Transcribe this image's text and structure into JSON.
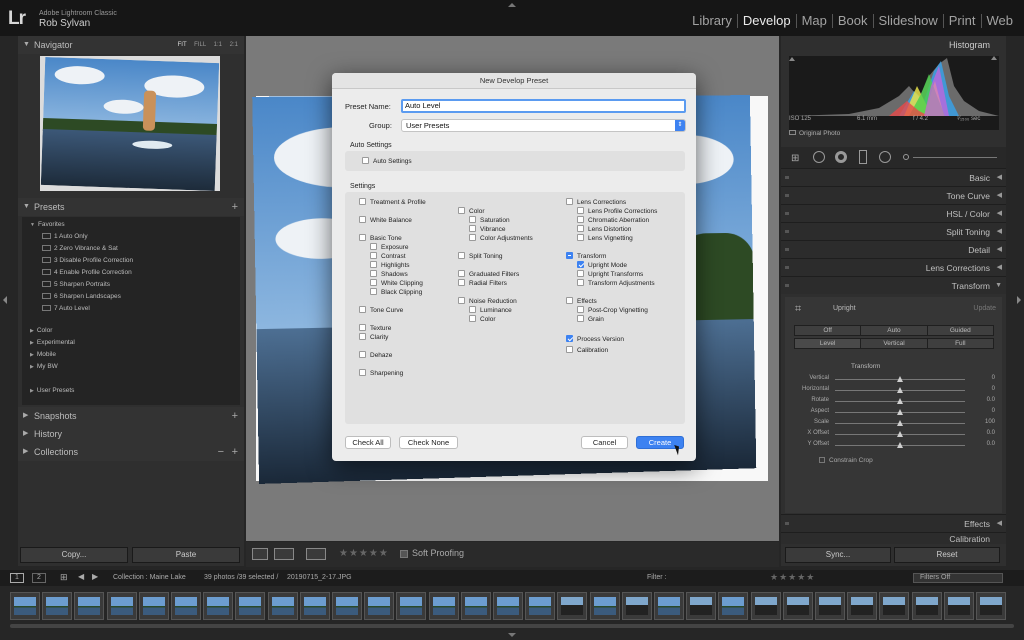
{
  "app": {
    "logo": "Lr",
    "product": "Adobe Lightroom Classic",
    "user": "Rob Sylvan"
  },
  "modules": [
    "Library",
    "Develop",
    "Map",
    "Book",
    "Slideshow",
    "Print",
    "Web"
  ],
  "active_module": "Develop",
  "left": {
    "navigator": {
      "title": "Navigator",
      "options": [
        "FIT",
        "FILL",
        "1:1",
        "2:1"
      ]
    },
    "presets": {
      "title": "Presets",
      "favorites_label": "Favorites",
      "favorites": [
        "1 Auto Only",
        "2 Zero Vibrance & Sat",
        "3 Disable Profile Correction",
        "4 Enable Profile Correction",
        "5 Sharpen Portraits",
        "6 Sharpen Landscapes",
        "7 Auto Level"
      ],
      "groups": [
        "Color",
        "Experimental",
        "Mobile",
        "My BW"
      ],
      "user_presets": "User Presets"
    },
    "snapshots": "Snapshots",
    "history": "History",
    "collections": "Collections",
    "copy_label": "Copy...",
    "paste_label": "Paste"
  },
  "toolbar": {
    "soft_proofing": "Soft Proofing",
    "stars": "★★★★★"
  },
  "right": {
    "histogram_title": "Histogram",
    "hist_info": {
      "iso": "ISO 125",
      "focal": "6.1 mm",
      "aperture": "f / 4.2",
      "shutter": "¹⁄₁₅₀₀ sec"
    },
    "original_photo": "Original Photo",
    "sections": [
      "Basic",
      "Tone Curve",
      "HSL / Color",
      "Split Toning",
      "Detail",
      "Lens Corrections",
      "Transform"
    ],
    "transform": {
      "upright_label": "Upright",
      "update_label": "Update",
      "row1": [
        "Off",
        "Auto",
        "Guided"
      ],
      "row2": [
        "Level",
        "Vertical",
        "Full"
      ],
      "section_label": "Transform",
      "sliders": [
        {
          "label": "Vertical",
          "value": "0",
          "pos": 0.5
        },
        {
          "label": "Horizontal",
          "value": "0",
          "pos": 0.5
        },
        {
          "label": "Rotate",
          "value": "0.0",
          "pos": 0.5
        },
        {
          "label": "Aspect",
          "value": "0",
          "pos": 0.5
        },
        {
          "label": "Scale",
          "value": "100",
          "pos": 0.5
        },
        {
          "label": "X Offset",
          "value": "0.0",
          "pos": 0.5
        },
        {
          "label": "Y Offset",
          "value": "0.0",
          "pos": 0.5
        }
      ],
      "constrain_crop": "Constrain Crop"
    },
    "effects": "Effects",
    "calibration": "Calibration",
    "sync_label": "Sync...",
    "reset_label": "Reset"
  },
  "filmbar": {
    "pages": [
      "1",
      "2"
    ],
    "collection": "Collection : Maine Lake",
    "count": "39 photos /39 selected /",
    "filename": "20190715_2-17.JPG",
    "filter_label": "Filter :",
    "filters_off": "Filters Off"
  },
  "dialog": {
    "title": "New Develop Preset",
    "preset_name_label": "Preset Name:",
    "preset_name_value": "Auto Level",
    "group_label": "Group:",
    "group_value": "User Presets",
    "auto_settings_header": "Auto Settings",
    "auto_settings_item": "Auto Settings",
    "settings_header": "Settings",
    "col1": [
      {
        "label": "Treatment & Profile",
        "state": "off",
        "indent": 0
      },
      {
        "label": "White Balance",
        "state": "off",
        "indent": 0
      },
      {
        "label": "Basic Tone",
        "state": "off",
        "indent": 0
      },
      {
        "label": "Exposure",
        "state": "off",
        "indent": 1
      },
      {
        "label": "Contrast",
        "state": "off",
        "indent": 1
      },
      {
        "label": "Highlights",
        "state": "off",
        "indent": 1
      },
      {
        "label": "Shadows",
        "state": "off",
        "indent": 1
      },
      {
        "label": "White Clipping",
        "state": "off",
        "indent": 1
      },
      {
        "label": "Black Clipping",
        "state": "off",
        "indent": 1
      },
      {
        "label": "Tone Curve",
        "state": "off",
        "indent": 0
      },
      {
        "label": "Texture",
        "state": "off",
        "indent": 0
      },
      {
        "label": "Clarity",
        "state": "off",
        "indent": 0
      },
      {
        "label": "Dehaze",
        "state": "off",
        "indent": 0
      },
      {
        "label": "Sharpening",
        "state": "off",
        "indent": 0
      }
    ],
    "col2": [
      {
        "label": "Color",
        "state": "off",
        "indent": 0
      },
      {
        "label": "Saturation",
        "state": "off",
        "indent": 1
      },
      {
        "label": "Vibrance",
        "state": "off",
        "indent": 1
      },
      {
        "label": "Color Adjustments",
        "state": "off",
        "indent": 1
      },
      {
        "label": "Split Toning",
        "state": "off",
        "indent": 0
      },
      {
        "label": "Graduated Filters",
        "state": "off",
        "indent": 0
      },
      {
        "label": "Radial Filters",
        "state": "off",
        "indent": 0
      },
      {
        "label": "Noise Reduction",
        "state": "off",
        "indent": 0
      },
      {
        "label": "Luminance",
        "state": "off",
        "indent": 1
      },
      {
        "label": "Color",
        "state": "off",
        "indent": 1
      }
    ],
    "col3": [
      {
        "label": "Lens Corrections",
        "state": "off",
        "indent": 0
      },
      {
        "label": "Lens Profile Corrections",
        "state": "off",
        "indent": 1
      },
      {
        "label": "Chromatic Aberration",
        "state": "off",
        "indent": 1
      },
      {
        "label": "Lens Distortion",
        "state": "off",
        "indent": 1
      },
      {
        "label": "Lens Vignetting",
        "state": "off",
        "indent": 1
      },
      {
        "label": "Transform",
        "state": "mixed",
        "indent": 0
      },
      {
        "label": "Upright Mode",
        "state": "checked",
        "indent": 1
      },
      {
        "label": "Upright Transforms",
        "state": "off",
        "indent": 1
      },
      {
        "label": "Transform Adjustments",
        "state": "off",
        "indent": 1
      },
      {
        "label": "Effects",
        "state": "off",
        "indent": 0
      },
      {
        "label": "Post-Crop Vignetting",
        "state": "off",
        "indent": 1
      },
      {
        "label": "Grain",
        "state": "off",
        "indent": 1
      },
      {
        "label": "Process Version",
        "state": "checked",
        "indent": 0
      },
      {
        "label": "Calibration",
        "state": "off",
        "indent": 0
      }
    ],
    "check_all": "Check All",
    "check_none": "Check None",
    "cancel": "Cancel",
    "create": "Create"
  },
  "colors": {
    "accent": "#3d82f1",
    "panel": "#2f2f2f",
    "dialog": "#ececec"
  }
}
